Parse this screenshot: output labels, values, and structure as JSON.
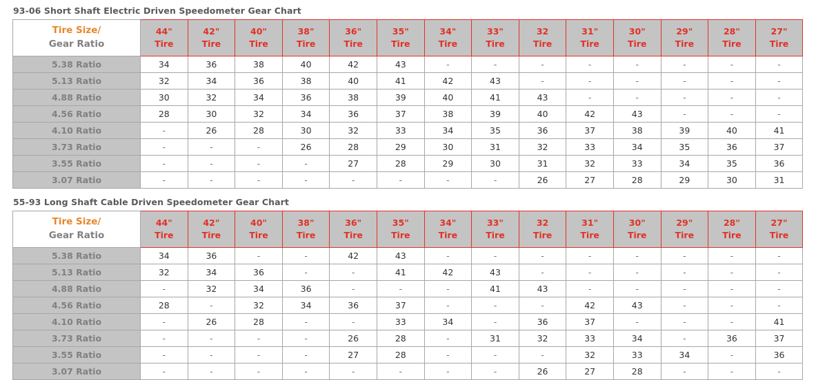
{
  "charts": [
    {
      "title": "93-06 Short Shaft Electric Driven Speedometer Gear Chart",
      "corner_top": "Tire Size/",
      "corner_bottom": "Gear Ratio",
      "tire_word": "Tire",
      "columns": [
        "44\"",
        "42\"",
        "40\"",
        "38\"",
        "36\"",
        "35\"",
        "34\"",
        "33\"",
        "32",
        "31\"",
        "30\"",
        "29\"",
        "28\"",
        "27\""
      ],
      "rows": [
        {
          "label": "5.38 Ratio",
          "values": [
            "34",
            "36",
            "38",
            "40",
            "42",
            "43",
            "-",
            "-",
            "-",
            "-",
            "-",
            "-",
            "-",
            "-"
          ]
        },
        {
          "label": "5.13 Ratio",
          "values": [
            "32",
            "34",
            "36",
            "38",
            "40",
            "41",
            "42",
            "43",
            "-",
            "-",
            "-",
            "-",
            "-",
            "-"
          ]
        },
        {
          "label": "4.88 Ratio",
          "values": [
            "30",
            "32",
            "34",
            "36",
            "38",
            "39",
            "40",
            "41",
            "43",
            "-",
            "-",
            "-",
            "-",
            "-"
          ]
        },
        {
          "label": "4.56 Ratio",
          "values": [
            "28",
            "30",
            "32",
            "34",
            "36",
            "37",
            "38",
            "39",
            "40",
            "42",
            "43",
            "-",
            "-",
            "-"
          ]
        },
        {
          "label": "4.10 Ratio",
          "values": [
            "-",
            "26",
            "28",
            "30",
            "32",
            "33",
            "34",
            "35",
            "36",
            "37",
            "38",
            "39",
            "40",
            "41"
          ]
        },
        {
          "label": "3.73 Ratio",
          "values": [
            "-",
            "-",
            "-",
            "26",
            "28",
            "29",
            "30",
            "31",
            "32",
            "33",
            "34",
            "35",
            "36",
            "37"
          ]
        },
        {
          "label": "3.55 Ratio",
          "values": [
            "-",
            "-",
            "-",
            "-",
            "27",
            "28",
            "29",
            "30",
            "31",
            "32",
            "33",
            "34",
            "35",
            "36"
          ]
        },
        {
          "label": "3.07 Ratio",
          "values": [
            "-",
            "-",
            "-",
            "-",
            "-",
            "-",
            "-",
            "-",
            "26",
            "27",
            "28",
            "29",
            "30",
            "31"
          ]
        }
      ]
    },
    {
      "title": "55-93 Long Shaft Cable Driven Speedometer Gear Chart",
      "corner_top": "Tire Size/",
      "corner_bottom": "Gear Ratio",
      "tire_word": "Tire",
      "columns": [
        "44\"",
        "42\"",
        "40\"",
        "38\"",
        "36\"",
        "35\"",
        "34\"",
        "33\"",
        "32",
        "31\"",
        "30\"",
        "29\"",
        "28\"",
        "27\""
      ],
      "rows": [
        {
          "label": "5.38 Ratio",
          "values": [
            "34",
            "36",
            "-",
            "-",
            "42",
            "43",
            "-",
            "-",
            "-",
            "-",
            "-",
            "-",
            "-",
            "-"
          ]
        },
        {
          "label": "5.13 Ratio",
          "values": [
            "32",
            "34",
            "36",
            "-",
            "-",
            "41",
            "42",
            "43",
            "-",
            "-",
            "-",
            "-",
            "-",
            "-"
          ]
        },
        {
          "label": "4.88 Ratio",
          "values": [
            "-",
            "32",
            "34",
            "36",
            "-",
            "-",
            "-",
            "41",
            "43",
            "-",
            "-",
            "-",
            "-",
            "-"
          ]
        },
        {
          "label": "4.56 Ratio",
          "values": [
            "28",
            "-",
            "32",
            "34",
            "36",
            "37",
            "-",
            "-",
            "-",
            "42",
            "43",
            "-",
            "-",
            "-"
          ]
        },
        {
          "label": "4.10 Ratio",
          "values": [
            "-",
            "26",
            "28",
            "-",
            "-",
            "33",
            "34",
            "-",
            "36",
            "37",
            "-",
            "-",
            "-",
            "41"
          ]
        },
        {
          "label": "3.73 Ratio",
          "values": [
            "-",
            "-",
            "-",
            "-",
            "26",
            "28",
            "-",
            "31",
            "32",
            "33",
            "34",
            "-",
            "36",
            "37"
          ]
        },
        {
          "label": "3.55 Ratio",
          "values": [
            "-",
            "-",
            "-",
            "-",
            "27",
            "28",
            "-",
            "-",
            "-",
            "32",
            "33",
            "34",
            "-",
            "36"
          ]
        },
        {
          "label": "3.07 Ratio",
          "values": [
            "-",
            "-",
            "-",
            "-",
            "-",
            "-",
            "-",
            "-",
            "26",
            "27",
            "28",
            "-",
            "-",
            "-"
          ]
        }
      ]
    }
  ],
  "colors": {
    "header_red": "#e03127",
    "accent_orange": "#e8862b",
    "header_gray_bg": "#c4c4c4",
    "label_gray_text": "#808080",
    "title_gray": "#595959",
    "grid_line": "#a6a6a6"
  }
}
